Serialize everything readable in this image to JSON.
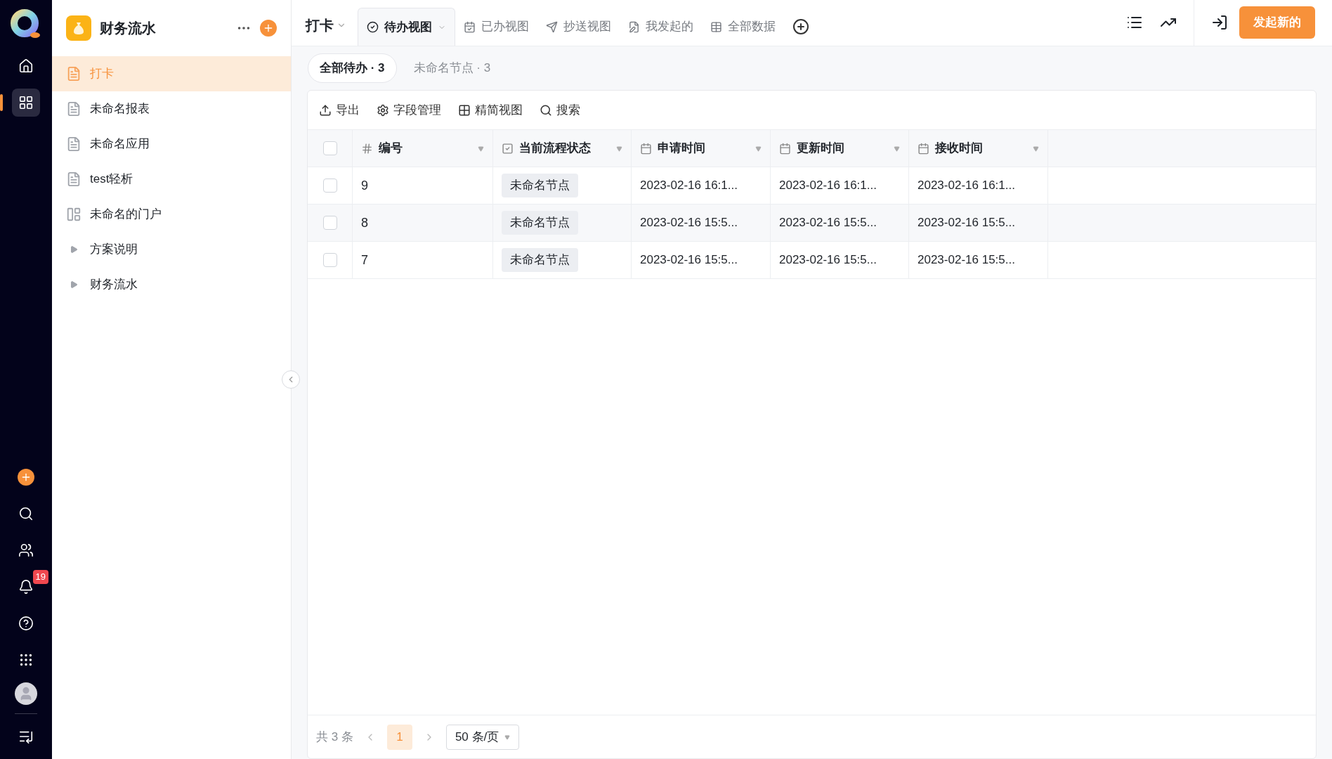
{
  "rail": {
    "badge": "19"
  },
  "app": {
    "title": "财务流水"
  },
  "sidebar": {
    "items": [
      {
        "label": "打卡",
        "kind": "page",
        "selected": true
      },
      {
        "label": "未命名报表",
        "kind": "page",
        "selected": false
      },
      {
        "label": "未命名应用",
        "kind": "page",
        "selected": false
      },
      {
        "label": "test轻析",
        "kind": "page",
        "selected": false
      },
      {
        "label": "未命名的门户",
        "kind": "portal",
        "selected": false
      },
      {
        "label": "方案说明",
        "kind": "folder",
        "selected": false,
        "expanded": false
      },
      {
        "label": "财务流水",
        "kind": "folder",
        "selected": false,
        "expanded": false
      }
    ]
  },
  "form_title": "打卡",
  "tabs": [
    {
      "label": "待办视图",
      "kind": "todo",
      "selected": true
    },
    {
      "label": "已办视图",
      "kind": "done",
      "selected": false
    },
    {
      "label": "抄送视图",
      "kind": "cc",
      "selected": false
    },
    {
      "label": "我发起的",
      "kind": "mine",
      "selected": false
    },
    {
      "label": "全部数据",
      "kind": "all",
      "selected": false
    }
  ],
  "new_button": "发起新的",
  "filters": [
    {
      "label": "全部待办 · 3",
      "selected": true
    },
    {
      "label": "未命名节点 · 3",
      "selected": false
    }
  ],
  "toolbar": [
    {
      "label": "导出",
      "kind": "export"
    },
    {
      "label": "字段管理",
      "kind": "fields"
    },
    {
      "label": "精简视图",
      "kind": "compact"
    },
    {
      "label": "搜索",
      "kind": "search"
    }
  ],
  "table": {
    "all_checked": false,
    "columns": [
      {
        "label": "编号",
        "kind": "number"
      },
      {
        "label": "当前流程状态",
        "kind": "check"
      },
      {
        "label": "申请时间",
        "kind": "date"
      },
      {
        "label": "更新时间",
        "kind": "date"
      },
      {
        "label": "接收时间",
        "kind": "date"
      }
    ],
    "rows": [
      {
        "checked": false,
        "cells": [
          "9",
          "未命名节点",
          "2023-02-16 16:1...",
          "2023-02-16 16:1...",
          "2023-02-16 16:1..."
        ]
      },
      {
        "checked": false,
        "cells": [
          "8",
          "未命名节点",
          "2023-02-16 15:5...",
          "2023-02-16 15:5...",
          "2023-02-16 15:5..."
        ]
      },
      {
        "checked": false,
        "cells": [
          "7",
          "未命名节点",
          "2023-02-16 15:5...",
          "2023-02-16 15:5...",
          "2023-02-16 15:5..."
        ]
      }
    ]
  },
  "pagination": {
    "total": "共 3 条",
    "pages": [
      {
        "label": "1",
        "selected": true
      }
    ],
    "page_size": "50 条/页"
  }
}
